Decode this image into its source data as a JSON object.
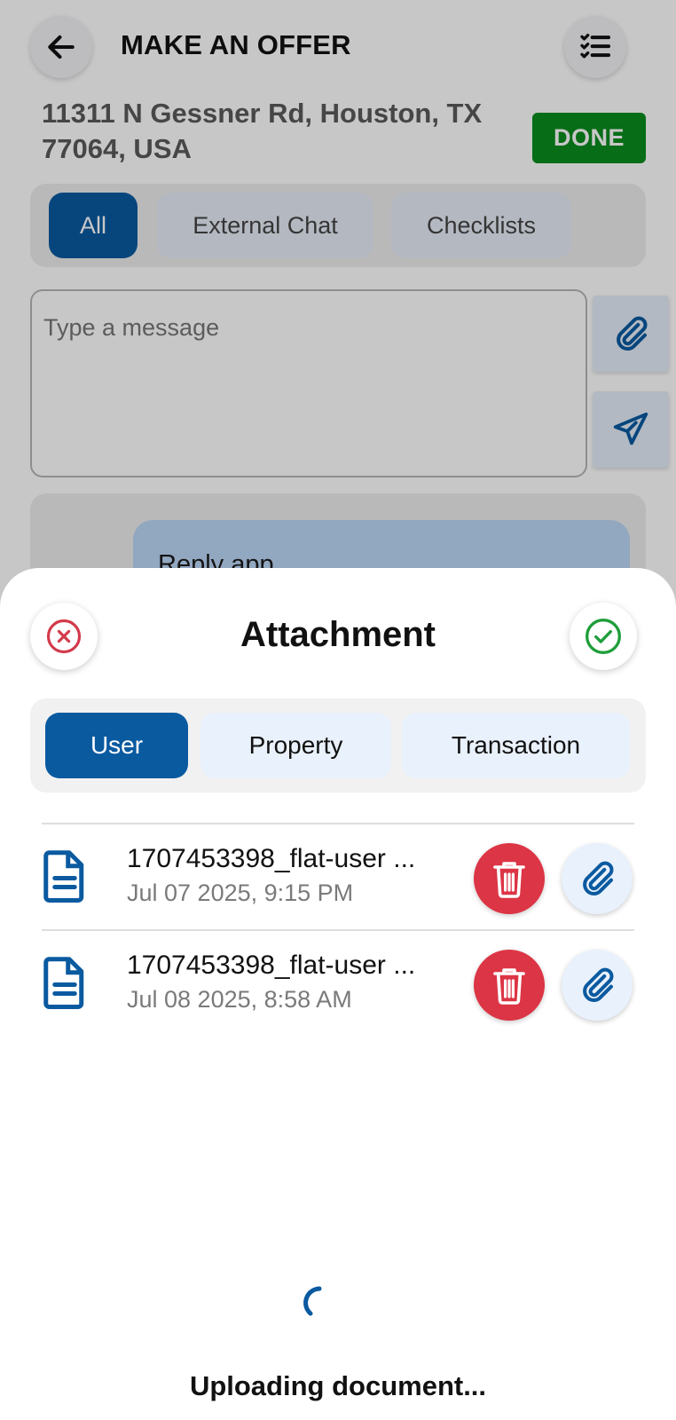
{
  "header": {
    "title": "MAKE AN OFFER",
    "back_icon": "arrow-left-icon",
    "checklist_icon": "checklist-icon"
  },
  "property": {
    "address_line1": "11311 N Gessner Rd, Houston, TX",
    "address_line2": "77064, USA",
    "done_label": "DONE"
  },
  "tabs": [
    {
      "label": "All",
      "active": true
    },
    {
      "label": "External Chat",
      "active": false
    },
    {
      "label": "Checklists",
      "active": false
    }
  ],
  "composer": {
    "placeholder": "Type a message",
    "attach_icon": "paperclip-icon",
    "send_icon": "send-icon"
  },
  "chat": {
    "bubble_text": "Reply app"
  },
  "sheet": {
    "title": "Attachment",
    "close_icon": "close-circle-icon",
    "confirm_icon": "check-circle-icon",
    "segments": [
      {
        "label": "User",
        "active": true
      },
      {
        "label": "Property",
        "active": false
      },
      {
        "label": "Transaction",
        "active": false
      }
    ],
    "files": [
      {
        "name": "1707453398_flat-user ...",
        "date": "Jul 07 2025, 9:15 PM"
      },
      {
        "name": "1707453398_flat-user ...",
        "date": "Jul 08 2025, 8:58 AM"
      }
    ],
    "status_text": "Uploading document..."
  },
  "colors": {
    "primary": "#0a5aa0",
    "done_green": "#0a8c1e",
    "delete_red": "#dc3545",
    "light_blue": "#e9f1fc"
  }
}
